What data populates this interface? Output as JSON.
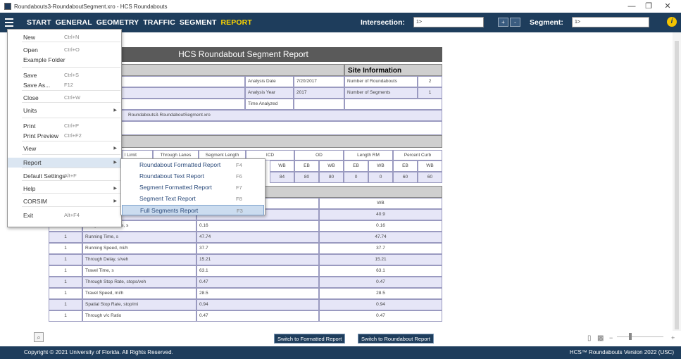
{
  "window": {
    "title": "Roundabouts3-RoundaboutSegment.xro - HCS Roundabouts",
    "minimize": "—",
    "restore": "❐",
    "close": "✕"
  },
  "ribbon": {
    "tabs": [
      "START",
      "GENERAL",
      "GEOMETRY",
      "TRAFFIC",
      "SEGMENT",
      "REPORT"
    ],
    "intersection_label": "Intersection:",
    "intersection_value": "1>",
    "add_btn": "+",
    "remove_btn": "-",
    "segment_label": "Segment:",
    "segment_value": "1>",
    "info_icon": "i"
  },
  "menu": {
    "items": [
      {
        "label": "New",
        "shortcut": "Ctrl+N"
      },
      {
        "label": "Open",
        "shortcut": "Ctrl+O"
      },
      {
        "label": "Example Folder",
        "shortcut": ""
      },
      {
        "label": "Save",
        "shortcut": "Ctrl+S"
      },
      {
        "label": "Save As...",
        "shortcut": "F12"
      },
      {
        "label": "Close",
        "shortcut": "Ctrl+W"
      },
      {
        "label": "Units",
        "shortcut": ""
      },
      {
        "label": "Print",
        "shortcut": "Ctrl+P"
      },
      {
        "label": "Print Preview",
        "shortcut": "Ctrl+F2"
      },
      {
        "label": "View",
        "shortcut": ""
      },
      {
        "label": "Report",
        "shortcut": ""
      },
      {
        "label": "Default Settings",
        "shortcut": "Alt+F"
      },
      {
        "label": "Help",
        "shortcut": ""
      },
      {
        "label": "CORSIM",
        "shortcut": ""
      },
      {
        "label": "Exit",
        "shortcut": "Alt+F4"
      }
    ],
    "report_submenu": [
      {
        "label": "Roundabout Formatted Report",
        "shortcut": "F4"
      },
      {
        "label": "Roundabout Text Report",
        "shortcut": "F6"
      },
      {
        "label": "Segment Formatted Report",
        "shortcut": "F7"
      },
      {
        "label": "Segment Text Report",
        "shortcut": "F8"
      },
      {
        "label": "Full Segments Report",
        "shortcut": "F3"
      }
    ]
  },
  "report": {
    "title": "HCS Roundabout Segment Report",
    "general_header": "n",
    "site_header": "Site Information",
    "analysis_date_label": "Analysis Date",
    "analysis_date": "7/20/2017",
    "analysis_year_label": "Analysis Year",
    "analysis_year": "2017",
    "time_analyzed_label": "Time Analyzed",
    "num_roundabouts_label": "Number of Roundabouts",
    "num_roundabouts": "2",
    "num_segments_label": "Number of Segments",
    "num_segments": "1",
    "file_name": "Roundabouts3-RoundaboutSegment.xro",
    "info_header": "mation",
    "geom_cols": [
      "l Limit",
      "Through Lanes",
      "Segment Length",
      "ICD",
      "OD",
      "Length RM",
      "Percent Curb"
    ],
    "geom_sub": [
      "EB",
      "WB",
      "EB",
      "WB",
      "EB",
      "WB",
      "EB",
      "WB"
    ],
    "geom_vals": [
      "84",
      "80",
      "80",
      "0",
      "0",
      "60",
      "60"
    ],
    "results_col_wb": "WB",
    "results": [
      {
        "seg": "1",
        "label": "e-Flow Speed, mi/h",
        "eb": "40.9",
        "wb": "40.9"
      },
      {
        "seg": "1",
        "label": "Delay due to Turns, s",
        "eb": "0.16",
        "wb": "0.16"
      },
      {
        "seg": "1",
        "label": "Running Time, s",
        "eb": "47.74",
        "wb": "47.74"
      },
      {
        "seg": "1",
        "label": "Running Speed, mi/h",
        "eb": "37.7",
        "wb": "37.7"
      },
      {
        "seg": "1",
        "label": "Through Delay, s/veh",
        "eb": "15.21",
        "wb": "15.21"
      },
      {
        "seg": "1",
        "label": "Travel Time, s",
        "eb": "63.1",
        "wb": "63.1"
      },
      {
        "seg": "1",
        "label": "Through Stop Rate, stops/veh",
        "eb": "0.47",
        "wb": "0.47"
      },
      {
        "seg": "1",
        "label": "Travel Speed, mi/h",
        "eb": "28.5",
        "wb": "28.5"
      },
      {
        "seg": "1",
        "label": "Spatial Stop Rate, stop/mi",
        "eb": "0.94",
        "wb": "0.94"
      },
      {
        "seg": "1",
        "label": "Through v/c Ratio",
        "eb": "0.47",
        "wb": "0.47"
      }
    ],
    "switch_formatted": "Switch to Formatted Report",
    "switch_roundabout": "Switch to Roundabout Report"
  },
  "footer": {
    "copyright": "Copyright © 2021 University of Florida. All Rights Reserved.",
    "version": "HCS™ Roundabouts Version 2022 (USC)"
  }
}
